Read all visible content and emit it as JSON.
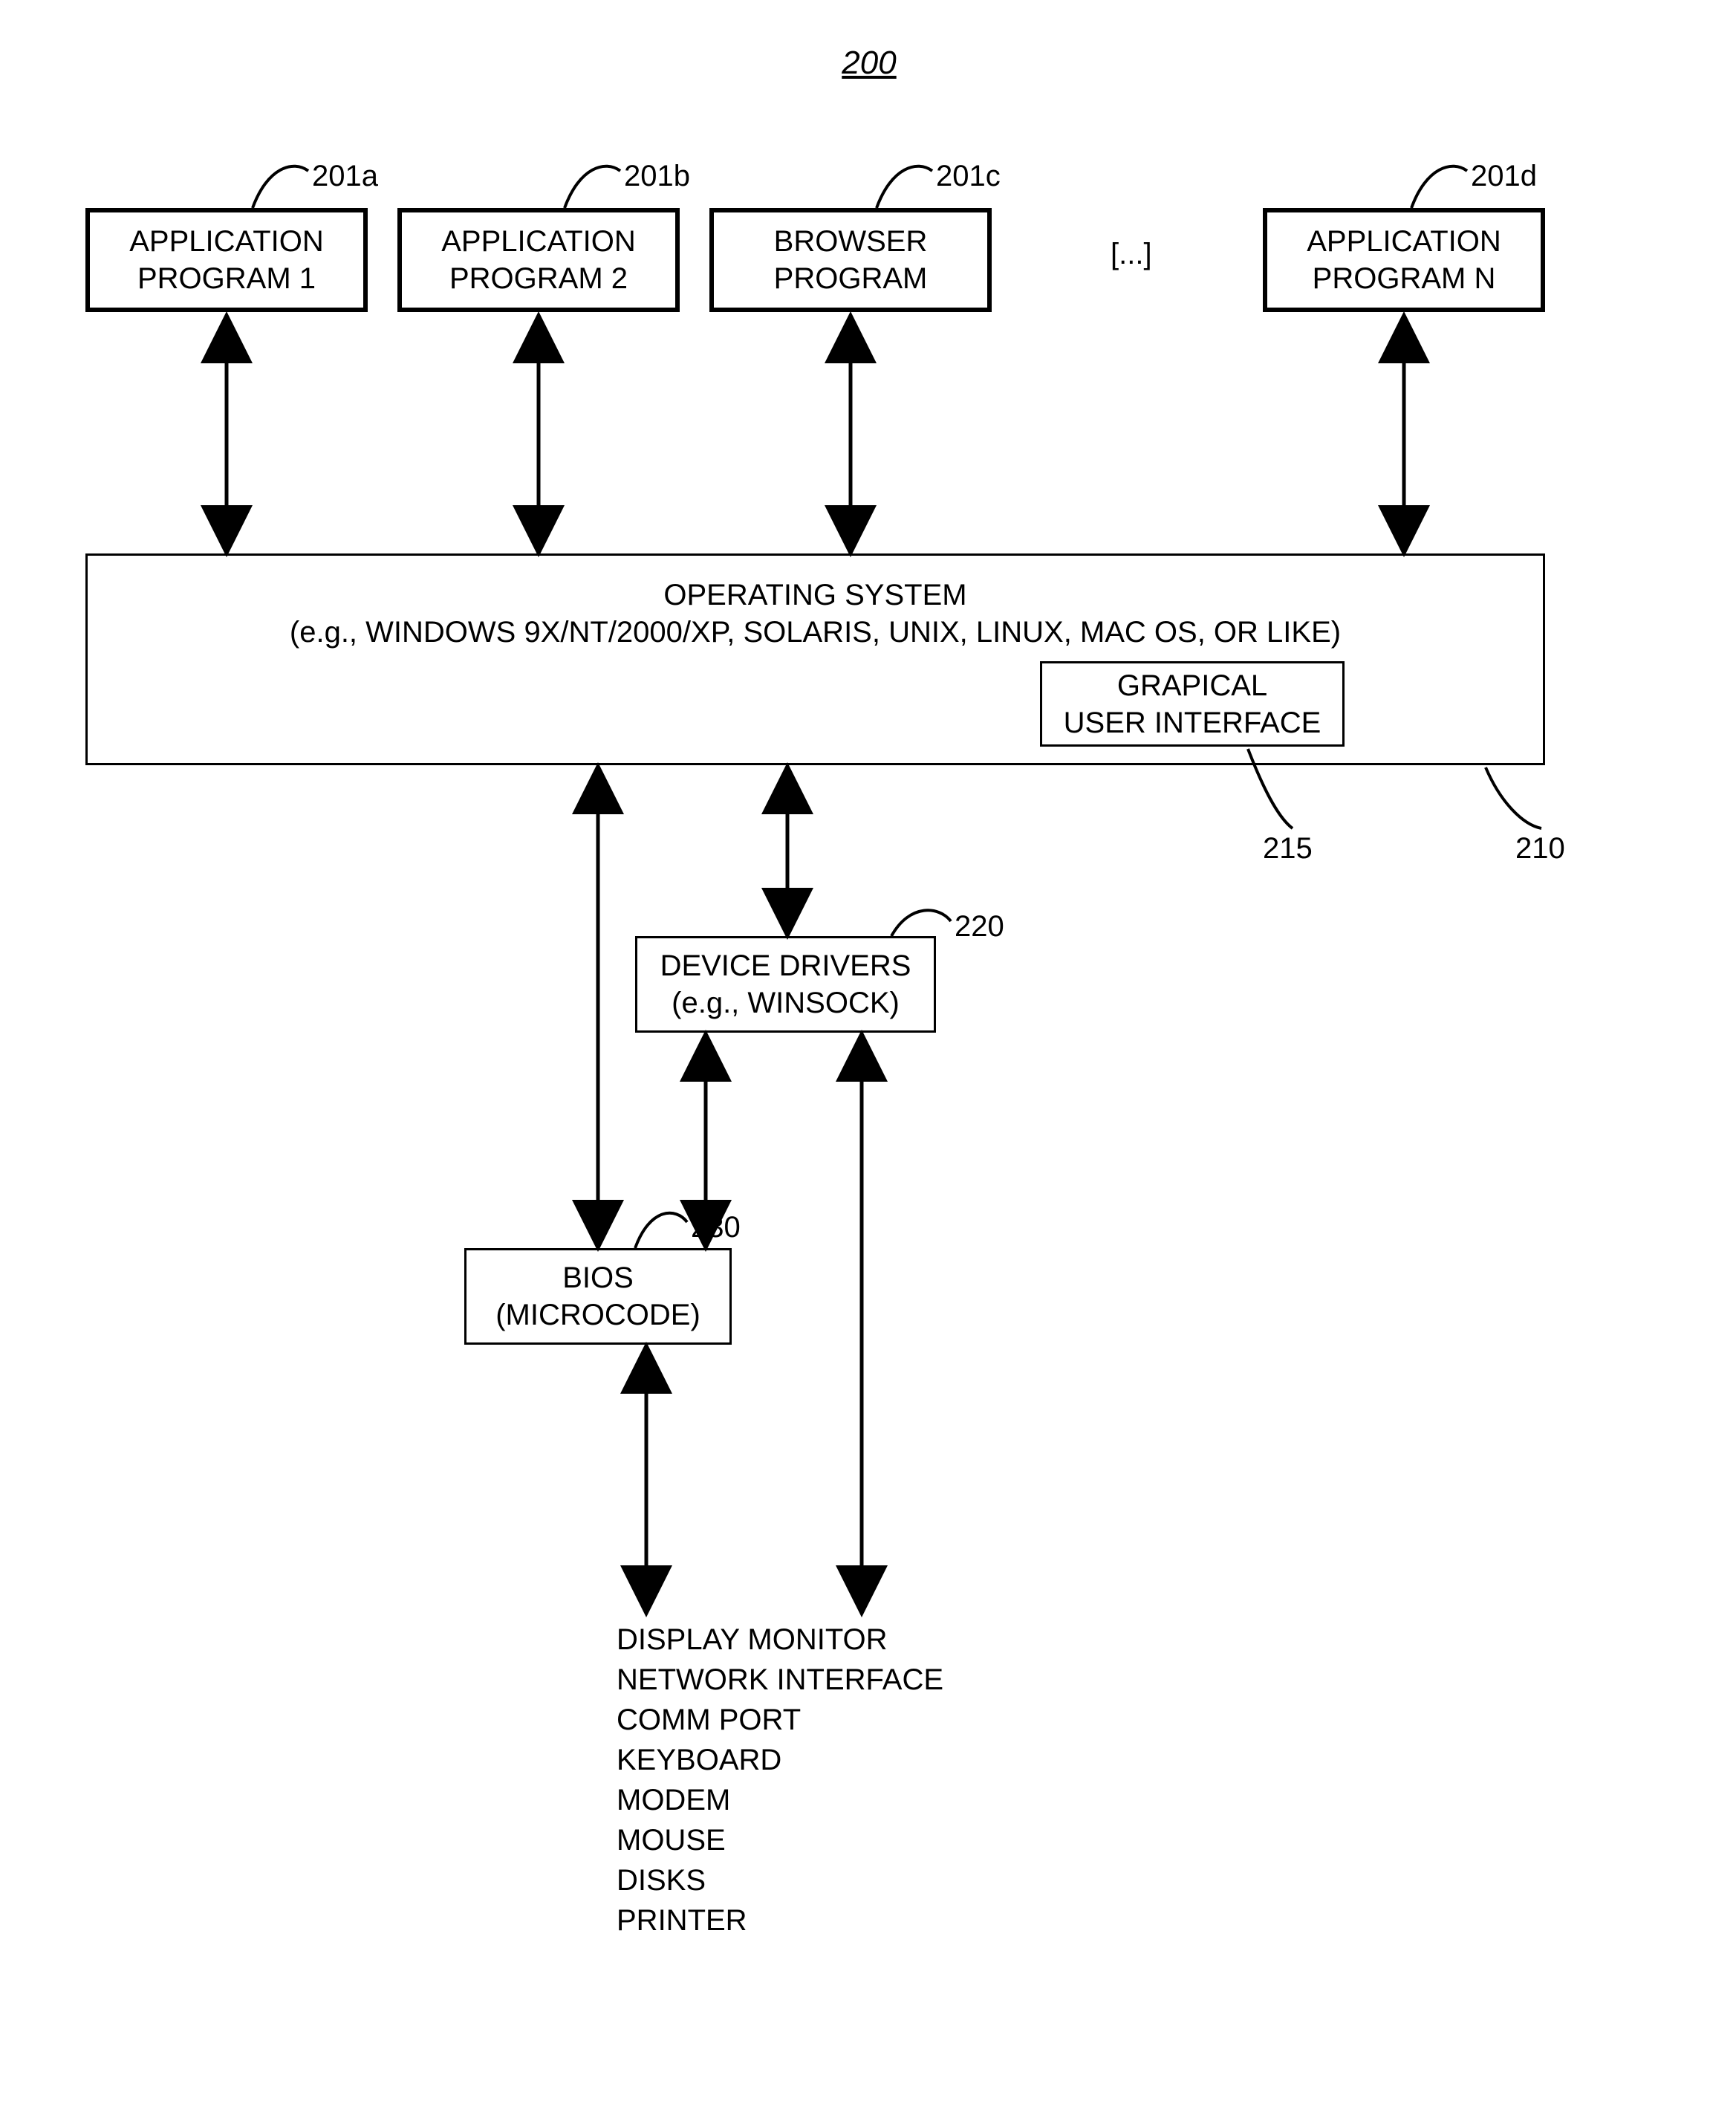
{
  "figure_number": "200",
  "refs": {
    "app1": "201a",
    "app2": "201b",
    "app3": "201c",
    "app4": "201d",
    "os": "210",
    "gui": "215",
    "drivers": "220",
    "bios": "230"
  },
  "apps": {
    "ellipsis": "[...]",
    "a": {
      "line1": "APPLICATION",
      "line2": "PROGRAM 1"
    },
    "b": {
      "line1": "APPLICATION",
      "line2": "PROGRAM 2"
    },
    "c": {
      "line1": "BROWSER",
      "line2": "PROGRAM"
    },
    "d": {
      "line1": "APPLICATION",
      "line2": "PROGRAM N"
    }
  },
  "os": {
    "line1": "OPERATING SYSTEM",
    "line2": "(e.g., WINDOWS 9X/NT/2000/XP, SOLARIS, UNIX, LINUX, MAC OS, OR LIKE)"
  },
  "gui": {
    "line1": "GRAPICAL",
    "line2": "USER INTERFACE"
  },
  "drivers": {
    "line1": "DEVICE DRIVERS",
    "line2": "(e.g., WINSOCK)"
  },
  "bios": {
    "line1": "BIOS",
    "line2": "(MICROCODE)"
  },
  "hardware": [
    "DISPLAY MONITOR",
    "NETWORK INTERFACE",
    "COMM PORT",
    "KEYBOARD",
    "MODEM",
    "MOUSE",
    "DISKS",
    "PRINTER"
  ]
}
